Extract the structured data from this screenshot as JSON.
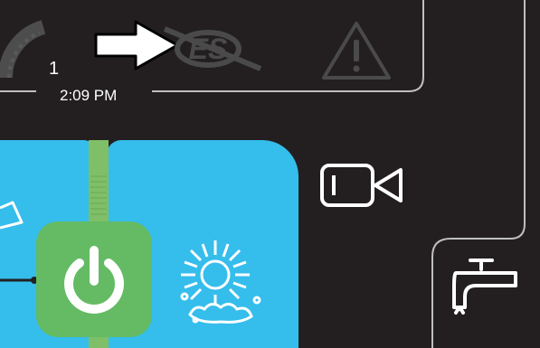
{
  "status": {
    "number": "1",
    "time": "2:09 PM"
  },
  "icons": {
    "gauge": "gauge-icon",
    "pointer_arrow": "arrow-right-icon",
    "badge": "emissions-badge-icon",
    "warning": "warning-triangle-icon",
    "camera": "camera-icon",
    "faucet": "faucet-icon",
    "power": "power-icon",
    "sun_wash": "sun-wash-icon"
  },
  "colors": {
    "background": "#231f20",
    "panel": "#35bdec",
    "power_button": "#64bb64",
    "connector": "#7fbf67",
    "outline": "#bfbfbf"
  }
}
